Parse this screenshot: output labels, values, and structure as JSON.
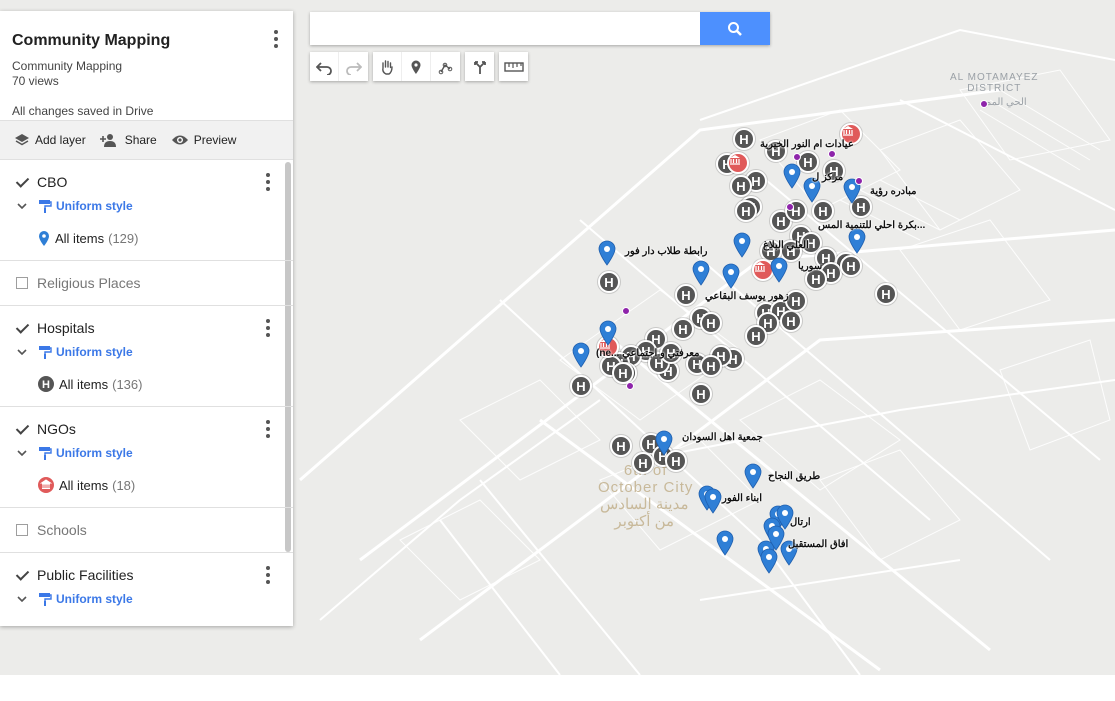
{
  "panel": {
    "title": "Community Mapping",
    "subtitle": "Community Mapping",
    "views": "70 views",
    "saved_status": "All changes saved in Drive",
    "actions": {
      "add_layer": "Add layer",
      "share": "Share",
      "preview": "Preview"
    }
  },
  "layers": [
    {
      "name": "CBO",
      "checked": true,
      "style": "Uniform style",
      "items_label": "All items",
      "items_count": "(129)",
      "icon": "blue-pin"
    },
    {
      "name": "Religious Places",
      "checked": false
    },
    {
      "name": "Hospitals",
      "checked": true,
      "style": "Uniform style",
      "items_label": "All items",
      "items_count": "(136)",
      "icon": "hospital-H"
    },
    {
      "name": "NGOs",
      "checked": true,
      "style": "Uniform style",
      "items_label": "All items",
      "items_count": "(18)",
      "icon": "red-institution"
    },
    {
      "name": "Schools",
      "checked": false
    },
    {
      "name": "Public Facilities",
      "checked": true,
      "style": "Uniform style"
    }
  ],
  "search": {
    "value": "",
    "placeholder": ""
  },
  "toolbar": [
    "undo",
    "redo",
    "hand",
    "add-marker",
    "draw-line",
    "directions",
    "measure"
  ],
  "map_labels": {
    "district_en": "AL MOTAMAYEZ\nDISTRICT",
    "district_ar": "الحي المم",
    "city_en": "6th of\nOctober City",
    "city_ar": "مدينة السادس\nمن أكتوبر",
    "place_1": "عيادات ام النور الخيرية",
    "place_2": "مركز ل",
    "place_3": "مبادره رؤية",
    "place_4": "بكرة احلي للتنمية المس...",
    "place_5": "رابطة طلاب دار فور",
    "place_6": "العلي البلاغ",
    "place_7": "سوريا",
    "place_8": "زهور يوسف البقاعي",
    "place_9": "(ne... معرفتي و اجتماعي",
    "place_10": "جمعية اهل السودان",
    "place_11": "طريق النجاح",
    "place_12": "ابناء الفور",
    "place_13": "ارتال",
    "place_14": "افاق المستقبل"
  },
  "colors": {
    "pin_blue": "#2f7fd6",
    "hospital_gray": "#555555",
    "ngo_red": "#e05a5a",
    "search_blue": "#4d90fe",
    "link_blue": "#3b78e7"
  }
}
